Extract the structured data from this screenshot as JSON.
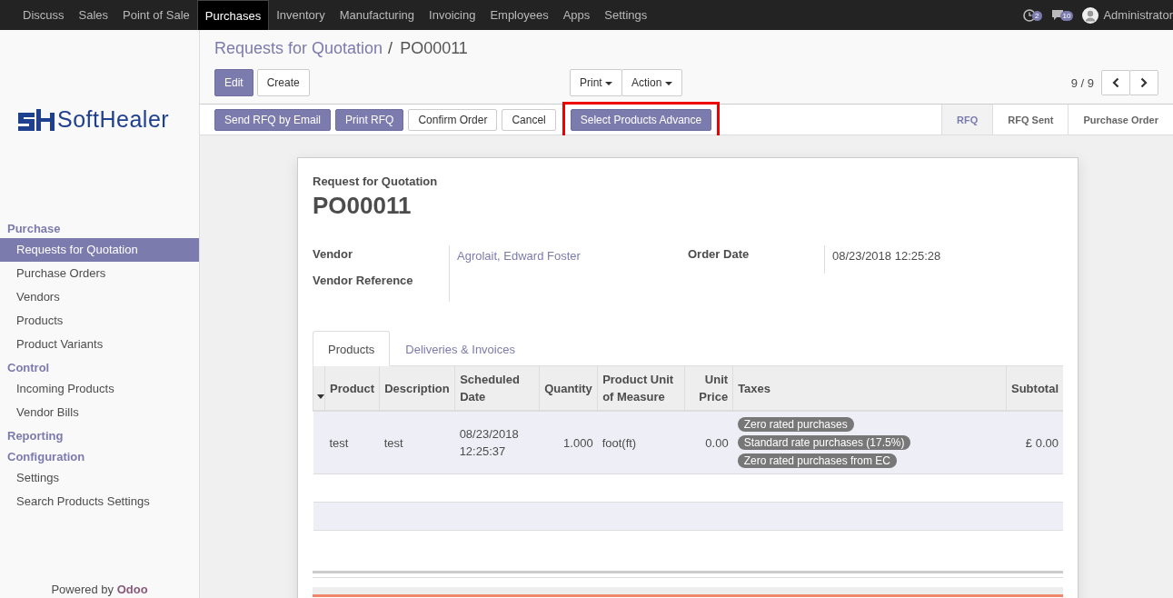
{
  "top_menu": [
    {
      "label": "Discuss",
      "selected": false
    },
    {
      "label": "Sales",
      "selected": false
    },
    {
      "label": "Point of Sale",
      "selected": false
    },
    {
      "label": "Purchases",
      "selected": true
    },
    {
      "label": "Inventory",
      "selected": false
    },
    {
      "label": "Manufacturing",
      "selected": false
    },
    {
      "label": "Invoicing",
      "selected": false
    },
    {
      "label": "Employees",
      "selected": false
    },
    {
      "label": "Apps",
      "selected": false
    },
    {
      "label": "Settings",
      "selected": false
    }
  ],
  "systray": {
    "activities_badge": "2",
    "messages_badge": "10",
    "user": "Administrator"
  },
  "sidebar": {
    "logo": {
      "left": "Soft",
      "right": "Healer"
    },
    "sections": [
      {
        "title": "Purchase",
        "items": [
          {
            "label": "Requests for Quotation",
            "selected": true
          },
          {
            "label": "Purchase Orders",
            "selected": false
          },
          {
            "label": "Vendors",
            "selected": false
          },
          {
            "label": "Products",
            "selected": false
          },
          {
            "label": "Product Variants",
            "selected": false
          }
        ]
      },
      {
        "title": "Control",
        "items": [
          {
            "label": "Incoming Products",
            "selected": false
          },
          {
            "label": "Vendor Bills",
            "selected": false
          }
        ]
      },
      {
        "title": "Reporting"
      },
      {
        "title": "Configuration",
        "items": [
          {
            "label": "Settings",
            "selected": false
          },
          {
            "label": "Search Products Settings",
            "selected": false
          }
        ]
      }
    ],
    "footer": {
      "text": "Powered by",
      "brand": "Odoo"
    }
  },
  "breadcrumb": {
    "parent": "Requests for Quotation",
    "separator": "/",
    "current": "PO00011"
  },
  "buttons": [
    {
      "label": "Edit",
      "kind": "primary"
    },
    {
      "label": "Create",
      "kind": "default"
    }
  ],
  "dropdowns": [
    "Print",
    "Action"
  ],
  "pager": "9 / 9",
  "header_buttons": [
    {
      "label": "Send RFQ by Email",
      "kind": "primary",
      "highlighted": false
    },
    {
      "label": "Print RFQ",
      "kind": "primary",
      "highlighted": false
    },
    {
      "label": "Confirm Order",
      "kind": "default",
      "highlighted": false
    },
    {
      "label": "Cancel",
      "kind": "default",
      "highlighted": false
    },
    {
      "label": "Select Products Advance",
      "kind": "primary",
      "highlighted": true
    }
  ],
  "stages": [
    {
      "label": "RFQ",
      "selected": true
    },
    {
      "label": "RFQ Sent",
      "selected": false
    },
    {
      "label": "Purchase Order",
      "selected": false
    }
  ],
  "sheet": {
    "subtitle": "Request for Quotation",
    "title": "PO00011",
    "fields_left": [
      {
        "label": "Vendor",
        "value": "Agrolait, Edward Foster"
      },
      {
        "label": "Vendor Reference"
      }
    ],
    "fields_right": [
      {
        "label": "Order Date",
        "value": "08/23/2018 12:25:28"
      }
    ],
    "tabs": [
      {
        "label": "Products",
        "selected": true
      },
      {
        "label": "Deliveries & Invoices",
        "selected": false
      }
    ],
    "table": {
      "columns": [
        "Product",
        "Description",
        "Scheduled Date",
        "Quantity",
        "Product Unit of Measure",
        "Unit Price",
        "Taxes",
        "Subtotal"
      ],
      "rows": [
        {
          "product": "test",
          "description": "test",
          "scheduled_date": "08/23/2018 12:25:37",
          "quantity": "1.000",
          "uom": "foot(ft)",
          "unit_price": "0.00",
          "taxes": [
            "Zero rated purchases",
            "Standard rate purchases (17.5%)",
            "Zero rated purchases from EC"
          ],
          "subtotal": "£ 0.00"
        }
      ]
    }
  }
}
